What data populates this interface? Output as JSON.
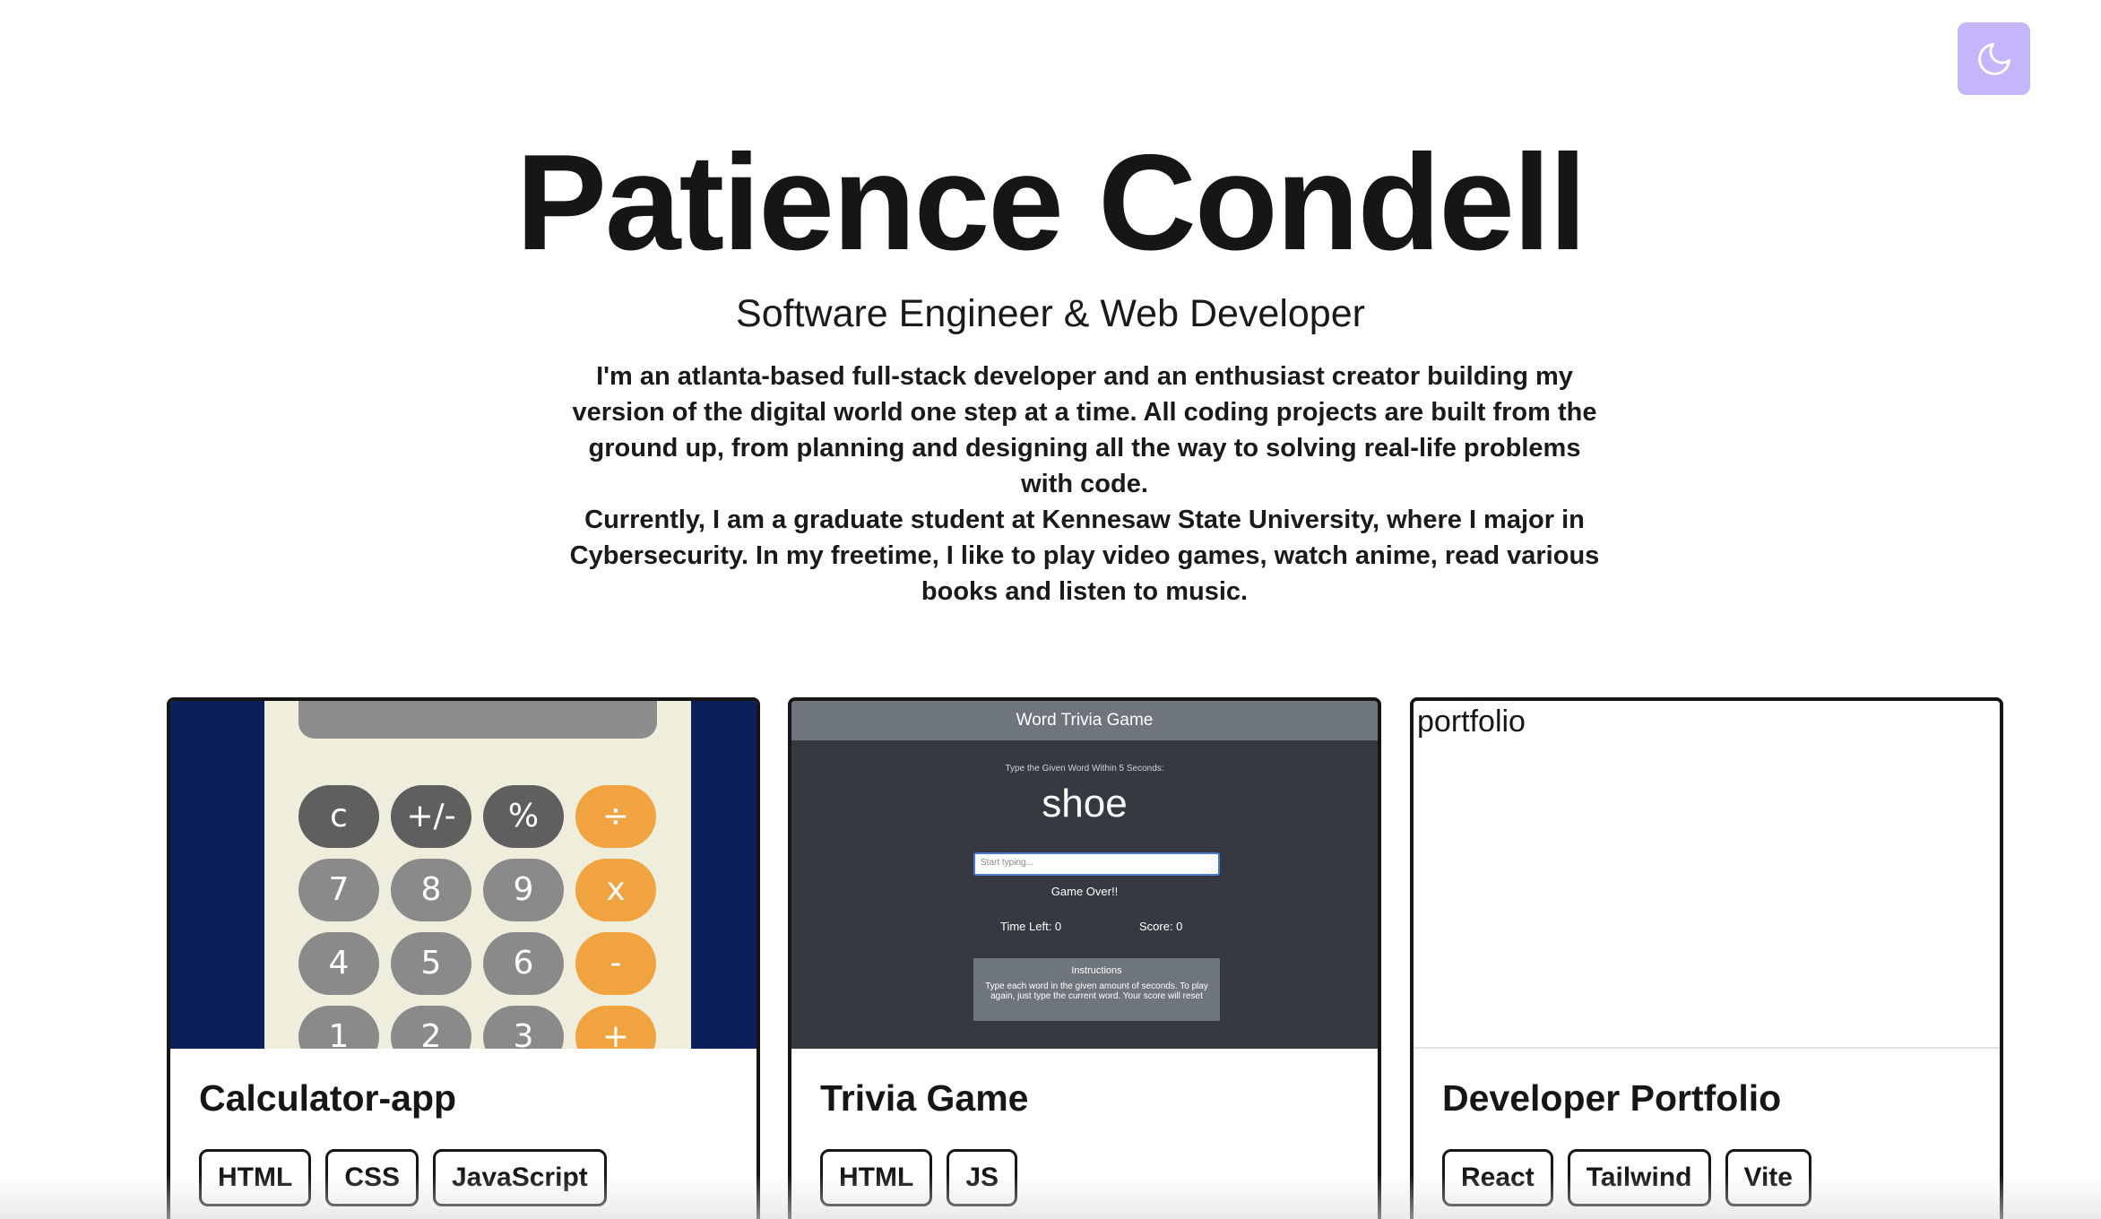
{
  "hero": {
    "name": "Patience Condell",
    "subtitle": "Software Engineer & Web Developer",
    "bio_1": "I'm an atlanta-based full-stack developer and an enthusiast creator building my version of the digital world one step at a time. All coding projects are built from the ground up, from planning and designing all the way to solving real-life problems with code.",
    "bio_2": "Currently, I am a graduate student at Kennesaw State University, where I major in Cybersecurity. In my freetime, I like to play video games, watch anime, read various books and listen to music."
  },
  "theme_toggle": {
    "icon": "moon-icon",
    "color": "#c4b5fd"
  },
  "projects": [
    {
      "title": "Calculator-app",
      "tags": [
        "HTML",
        "CSS",
        "JavaScript"
      ],
      "preview": {
        "buttons": [
          [
            "c",
            "+/-",
            "%",
            "÷"
          ],
          [
            "7",
            "8",
            "9",
            "x"
          ],
          [
            "4",
            "5",
            "6",
            "-"
          ],
          [
            "1",
            "2",
            "3",
            "+"
          ]
        ]
      }
    },
    {
      "title": "Trivia Game",
      "tags": [
        "HTML",
        "JS"
      ],
      "preview": {
        "header": "Word Trivia Game",
        "prompt": "Type the Given Word Within 5 Seconds:",
        "word": "shoe",
        "input_placeholder": "Start typing...",
        "status": "Game Over!!",
        "time_left": "Time Left: 0",
        "score": "Score: 0",
        "instructions_title": "Instructions",
        "instructions_text": "Type each word in the given amount of seconds. To play again, just type the current word. Your score will reset"
      }
    },
    {
      "title": "Developer Portfolio",
      "tags": [
        "React",
        "Tailwind",
        "Vite"
      ],
      "preview": {
        "alt": "portfolio"
      }
    }
  ],
  "colors": {
    "text": "#161616",
    "accent": "#c4b5fd",
    "calc_orange": "#f0a33e",
    "calc_navy": "#0c1f5a"
  }
}
